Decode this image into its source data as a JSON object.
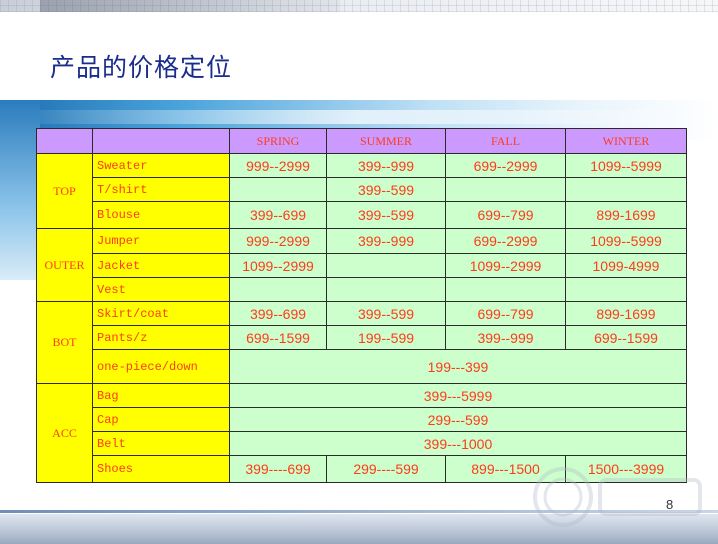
{
  "title": "产品的价格定位",
  "page_number": "8",
  "table": {
    "columns": [
      "",
      "",
      "SPRING",
      "SUMMER",
      "FALL",
      "WINTER"
    ],
    "groups": [
      {
        "category": "TOP",
        "rows": [
          {
            "item": "Sweater",
            "spring": "999--2999",
            "summer": "399--999",
            "fall": "699--2999",
            "winter": "1099--5999"
          },
          {
            "item": "T/shirt",
            "spring": "",
            "summer": "399--599",
            "fall": "",
            "winter": ""
          },
          {
            "item": "Blouse",
            "spring": "399--699",
            "summer": "399--599",
            "fall": "699--799",
            "winter": "899-1699"
          }
        ]
      },
      {
        "category": "OUTER",
        "rows": [
          {
            "item": "Jumper",
            "spring": "999--2999",
            "summer": "399--999",
            "fall": "699--2999",
            "winter": "1099--5999"
          },
          {
            "item": "Jacket",
            "spring": "1099--2999",
            "summer": "",
            "fall": "1099--2999",
            "winter": "1099-4999"
          },
          {
            "item": "Vest",
            "spring": "",
            "summer": "",
            "fall": "",
            "winter": ""
          }
        ]
      },
      {
        "category": "BOT",
        "rows": [
          {
            "item": "Skirt/coat",
            "spring": "399--699",
            "summer": "399--599",
            "fall": "699--799",
            "winter": "899-1699"
          },
          {
            "item": "Pants/z",
            "spring": "699--1599",
            "summer": "199--599",
            "fall": "399--999",
            "winter": "699--1599"
          },
          {
            "item": "one-piece/down",
            "all": "199---399"
          }
        ]
      },
      {
        "category": "ACC",
        "rows": [
          {
            "item": "Bag",
            "all": "399---5999"
          },
          {
            "item": "Cap",
            "all": "299---599"
          },
          {
            "item": "Belt",
            "all": "399---1000"
          },
          {
            "item": "Shoes",
            "spring": "399----699",
            "summer": "299----599",
            "fall": "899---1500",
            "winter": "1500---3999"
          }
        ]
      }
    ]
  },
  "colors": {
    "header_bg": "#cc99ff",
    "label_bg": "#ffff00",
    "value_bg": "#ccffcc",
    "text": "#ff3b1a",
    "title": "#1a2c8c"
  }
}
